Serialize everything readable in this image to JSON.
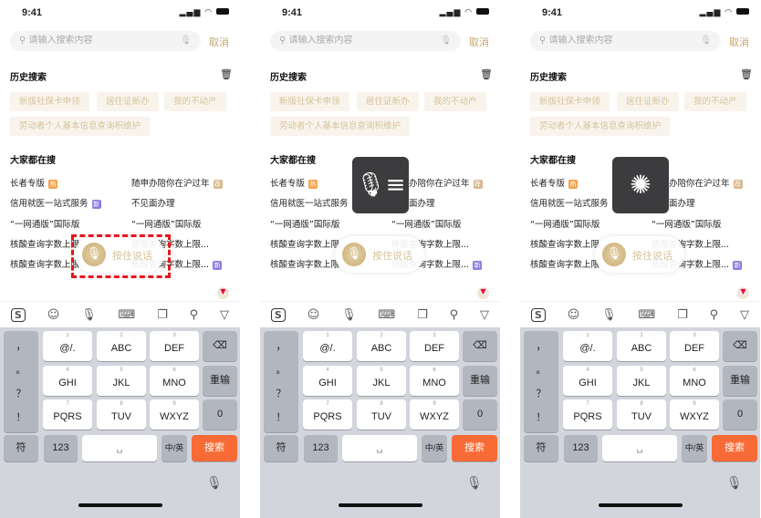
{
  "status": {
    "time": "9:41",
    "signal": "signal-icon",
    "wifi": "wifi-icon",
    "battery": "battery-icon"
  },
  "search": {
    "placeholder": "请输入搜索内容",
    "cancel": "取消"
  },
  "history": {
    "title": "历史搜索",
    "items": [
      "新版社保卡申领",
      "居住证新办",
      "我的不动产",
      "劳动者个人基本信息查询积维护"
    ]
  },
  "hot": {
    "title": "大家都在搜",
    "left": [
      {
        "text": "长者专版",
        "badge": "热"
      },
      {
        "text": "信用就医一站式服务",
        "badge": "新"
      },
      {
        "text": "“一网通版”国际版",
        "badge": ""
      },
      {
        "text": "核酸查询字数上限...",
        "badge": ""
      },
      {
        "text": "核酸查询字数上限...",
        "badge": ""
      }
    ],
    "right": [
      {
        "text": "随申办陪你在沪过年",
        "badge": "荐"
      },
      {
        "text": "不见面办理",
        "badge": ""
      },
      {
        "text": "“一网通版”国际版",
        "badge": ""
      },
      {
        "text": "核酸查询字数上限...",
        "badge": ""
      },
      {
        "text": "核酸查询字数上限...",
        "badge": "新"
      }
    ]
  },
  "badge_colors": {
    "热": "#f5a04a",
    "新": "#8a7ee0",
    "荐": "#d9b88c"
  },
  "voice": {
    "label": "按住说话"
  },
  "panels": [
    {
      "state": "idle",
      "highlighted": true
    },
    {
      "state": "listening",
      "highlighted": false
    },
    {
      "state": "recognizing",
      "highlighted": false
    }
  ],
  "keyboard": {
    "punct": [
      "，",
      "。",
      "？",
      "！"
    ],
    "keys": [
      {
        "n": "1",
        "l": "@/."
      },
      {
        "n": "2",
        "l": "ABC"
      },
      {
        "n": "3",
        "l": "DEF"
      },
      {
        "n": "4",
        "l": "GHI"
      },
      {
        "n": "5",
        "l": "JKL"
      },
      {
        "n": "6",
        "l": "MNO"
      },
      {
        "n": "7",
        "l": "PQRS"
      },
      {
        "n": "8",
        "l": "TUV"
      },
      {
        "n": "9",
        "l": "WXYZ"
      }
    ],
    "backspace": "⌫",
    "reenter": "重输",
    "zero": "0",
    "symbols": "符",
    "num": "123",
    "lang": "中/英",
    "search": "搜索",
    "search_color": "#f86b36"
  }
}
